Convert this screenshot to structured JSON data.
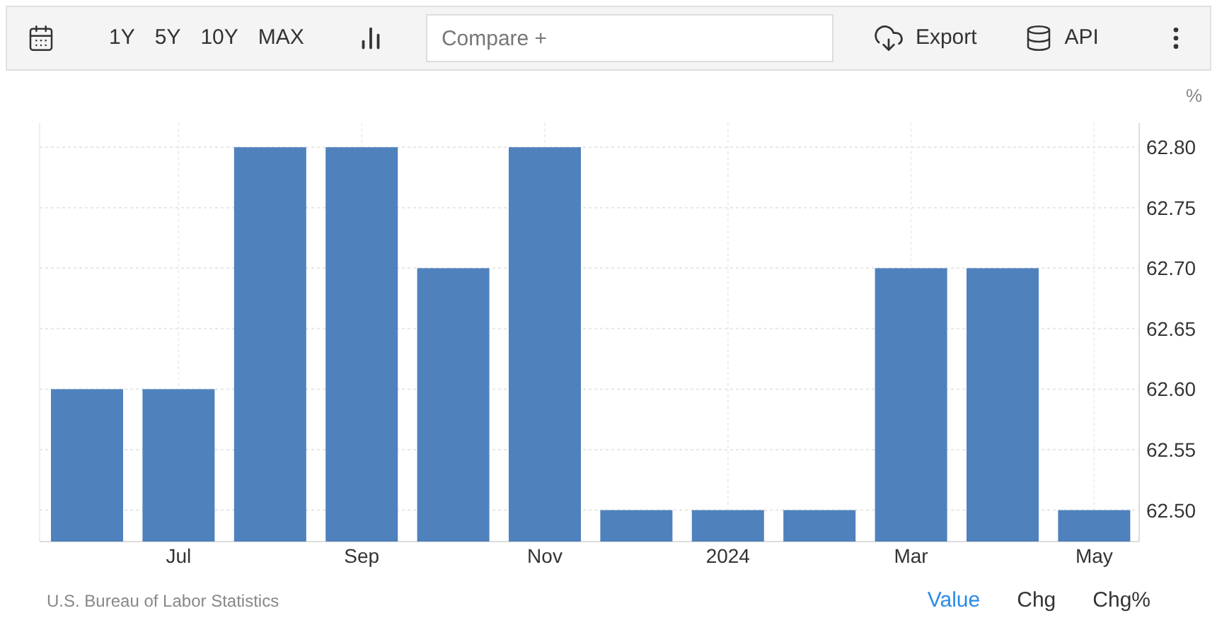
{
  "toolbar": {
    "range_buttons": [
      "1Y",
      "5Y",
      "10Y",
      "MAX"
    ],
    "compare": {
      "placeholder": "Compare +"
    },
    "export": "Export",
    "api": "API"
  },
  "chart": {
    "unit": "%",
    "chart_data": {
      "type": "bar",
      "grid": true,
      "ylim": [
        62.474,
        62.82
      ],
      "yticks": [
        {
          "value": 62.5,
          "label": "62.50"
        },
        {
          "value": 62.55,
          "label": "62.55"
        },
        {
          "value": 62.6,
          "label": "62.60"
        },
        {
          "value": 62.65,
          "label": "62.65"
        },
        {
          "value": 62.7,
          "label": "62.70"
        },
        {
          "value": 62.75,
          "label": "62.75"
        },
        {
          "value": 62.8,
          "label": "62.80"
        }
      ],
      "categories": [
        null,
        "Jul",
        null,
        "Sep",
        null,
        "Nov",
        null,
        "2024",
        null,
        "Mar",
        null,
        "May"
      ],
      "series": [
        {
          "color": "#4f81bd",
          "values": [
            62.6,
            62.6,
            62.8,
            62.8,
            62.7,
            62.8,
            62.5,
            62.5,
            62.5,
            62.7,
            62.7,
            62.5
          ]
        }
      ]
    }
  },
  "source": "U.S. Bureau of Labor Statistics",
  "view_options": [
    {
      "label": "Value",
      "selected": true
    },
    {
      "label": "Chg",
      "selected": false
    },
    {
      "label": "Chg%",
      "selected": false
    }
  ]
}
